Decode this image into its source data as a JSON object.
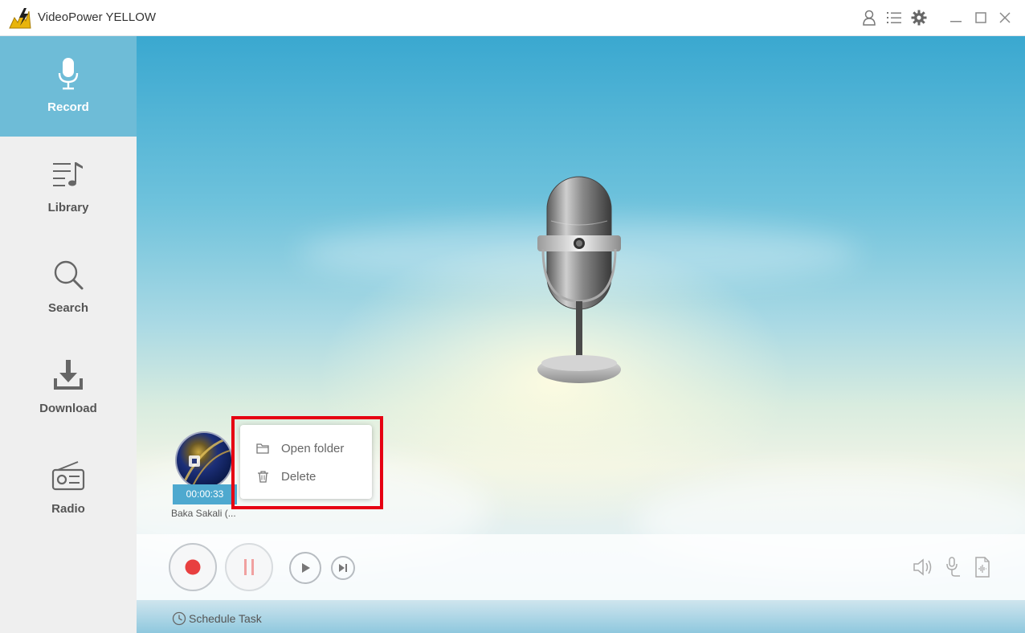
{
  "app": {
    "title": "VideoPower YELLOW"
  },
  "titlebar": {
    "icons": [
      "user-icon",
      "list-icon",
      "gear-icon",
      "minimize-icon",
      "maximize-icon",
      "close-icon"
    ]
  },
  "sidebar": {
    "items": [
      {
        "label": "Record",
        "icon": "microphone-icon",
        "active": true
      },
      {
        "label": "Library",
        "icon": "music-list-icon",
        "active": false
      },
      {
        "label": "Search",
        "icon": "search-icon",
        "active": false
      },
      {
        "label": "Download",
        "icon": "download-icon",
        "active": false
      },
      {
        "label": "Radio",
        "icon": "radio-icon",
        "active": false
      }
    ]
  },
  "recording": {
    "duration": "00:00:33",
    "name": "Baka Sakali (..."
  },
  "context_menu": {
    "items": [
      {
        "label": "Open folder",
        "icon": "folder-icon"
      },
      {
        "label": "Delete",
        "icon": "trash-icon"
      }
    ]
  },
  "controls": {
    "right_icons": [
      "speaker-icon",
      "microphone-source-icon",
      "audio-file-icon"
    ]
  },
  "bottom": {
    "schedule_label": "Schedule Task"
  },
  "colors": {
    "accent": "#6ebcd7",
    "record_red": "#e84040",
    "highlight": "#e60012"
  }
}
